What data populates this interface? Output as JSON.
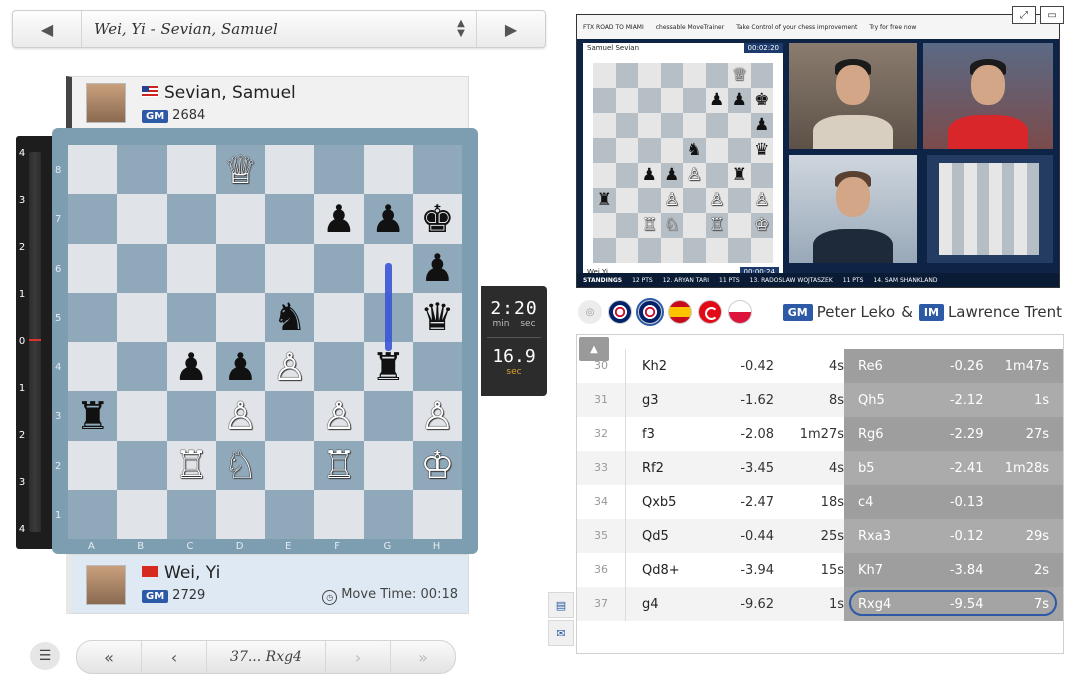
{
  "selector": {
    "title": "Wei, Yi - Sevian, Samuel"
  },
  "top_player": {
    "name": "Sevian, Samuel",
    "title": "GM",
    "rating": "2684",
    "flag": "us"
  },
  "bottom_player": {
    "name": "Wei, Yi",
    "title": "GM",
    "rating": "2729",
    "flag": "cn",
    "move_time_label": "Move Time: 00:18"
  },
  "eval_bar": {
    "marks": [
      "4",
      "3",
      "2",
      "1",
      "0",
      "1",
      "2",
      "3",
      "4"
    ]
  },
  "board": {
    "files": [
      "A",
      "B",
      "C",
      "D",
      "E",
      "F",
      "G",
      "H"
    ],
    "ranks": [
      "8",
      "7",
      "6",
      "5",
      "4",
      "3",
      "2",
      "1"
    ],
    "pieces": {
      "d8": "wQ",
      "f7": "bP",
      "g7": "bP",
      "h7": "bK",
      "h6": "bP",
      "e5": "bN",
      "h5": "bQ",
      "c4": "bP",
      "d4": "bP",
      "e4": "wP",
      "g4": "bR",
      "a3": "bR",
      "d3": "wP",
      "f3": "wP",
      "h3": "wP",
      "c2": "wR",
      "d2": "wN",
      "f2": "wR",
      "h2": "wK"
    }
  },
  "clock": {
    "main": "2:20",
    "min_label": "min",
    "sec_label": "sec",
    "move": "16.9",
    "move_unit": "sec"
  },
  "nav": {
    "move": "37... Rxg4"
  },
  "video": {
    "toolbar": [
      "FTX ROAD TO MIAMI",
      "chessable MoveTrainer",
      "Take Control of your chess improvement",
      "Try for free now"
    ],
    "top_name": "Samuel Sevian",
    "top_time": "00:02:20",
    "bottom_name": "Wei Yi",
    "bottom_time": "00:00:24",
    "standings_label": "STANDINGS",
    "standings": [
      "12 PTS",
      "12. ARYAN TARI",
      "11 PTS",
      "13. RADOSLAW WOJTASZEK",
      "11 PTS",
      "14. SAM SHANKLAND"
    ],
    "mini_pieces": {
      "g8": "wQ",
      "f7": "bP",
      "g7": "bP",
      "h7": "bK",
      "h6": "bP",
      "e5": "bN",
      "h5": "bQ",
      "c4": "bP",
      "d4": "bP",
      "e4": "wP",
      "g4": "bR",
      "a3": "bR",
      "d3": "wP",
      "f3": "wP",
      "h3": "wP",
      "c2": "wR",
      "d2": "wN",
      "f2": "wR",
      "h2": "wK"
    }
  },
  "commentary": {
    "c1_title": "GM",
    "c1_name": "Peter Leko",
    "amp": "&",
    "c2_title": "IM",
    "c2_name": "Lawrence Trent"
  },
  "moves": [
    {
      "num": "30",
      "white": "Kh2",
      "w_eval": "-0.42",
      "w_time": "4s",
      "black": "Re6",
      "b_eval": "-0.26",
      "b_time": "1m47s"
    },
    {
      "num": "31",
      "white": "g3",
      "w_eval": "-1.62",
      "w_time": "8s",
      "black": "Qh5",
      "b_eval": "-2.12",
      "b_time": "1s"
    },
    {
      "num": "32",
      "white": "f3",
      "w_eval": "-2.08",
      "w_time": "1m27s",
      "black": "Rg6",
      "b_eval": "-2.29",
      "b_time": "27s"
    },
    {
      "num": "33",
      "white": "Rf2",
      "w_eval": "-3.45",
      "w_time": "4s",
      "black": "b5",
      "b_eval": "-2.41",
      "b_time": "1m28s"
    },
    {
      "num": "34",
      "white": "Qxb5",
      "w_eval": "-2.47",
      "w_time": "18s",
      "black": "c4",
      "b_eval": "-0.13",
      "b_time": ""
    },
    {
      "num": "35",
      "white": "Qd5",
      "w_eval": "-0.44",
      "w_time": "25s",
      "black": "Rxa3",
      "b_eval": "-0.12",
      "b_time": "29s"
    },
    {
      "num": "36",
      "white": "Qd8+",
      "w_eval": "-3.94",
      "w_time": "15s",
      "black": "Kh7",
      "b_eval": "-3.84",
      "b_time": "2s"
    },
    {
      "num": "37",
      "white": "g4",
      "w_eval": "-9.62",
      "w_time": "1s",
      "black": "Rxg4",
      "b_eval": "-9.54",
      "b_time": "7s"
    }
  ],
  "icons": {
    "selector_prev": "triangle-left",
    "selector_next": "triangle-right",
    "nav_first": "double-chevron-left",
    "nav_prev": "chevron-left",
    "nav_next": "chevron-right",
    "nav_last": "double-chevron-right",
    "menu": "hamburger",
    "clock": "clock",
    "collapse": "triangle-up"
  }
}
